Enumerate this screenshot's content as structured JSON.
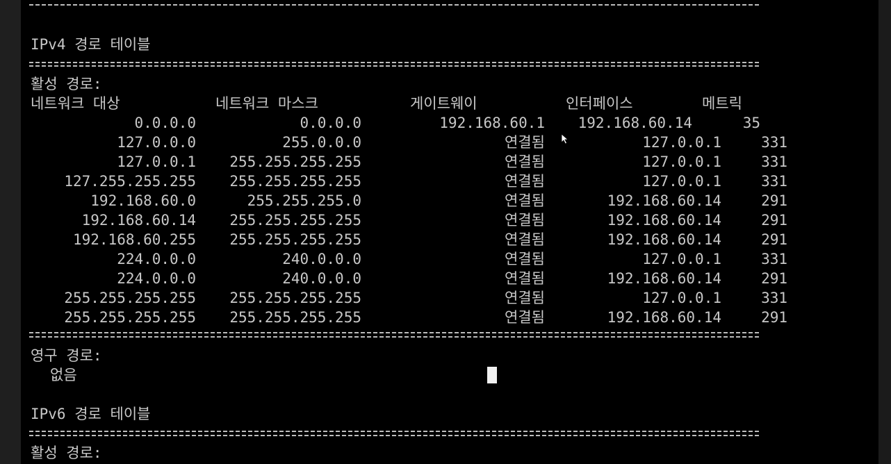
{
  "ipv4": {
    "title": "IPv4 경로 테이블",
    "active_label": "활성 경로:",
    "headers": {
      "destination": "네트워크 대상",
      "mask": "네트워크 마스크",
      "gateway": "게이트웨이",
      "interface": "인터페이스",
      "metric": "메트릭"
    },
    "rows": [
      {
        "destination": "0.0.0.0",
        "mask": "0.0.0.0",
        "gateway": "192.168.60.1",
        "interface": "192.168.60.14",
        "metric": "35"
      },
      {
        "destination": "127.0.0.0",
        "mask": "255.0.0.0",
        "gateway": "연결됨",
        "interface": "127.0.0.1",
        "metric": "331"
      },
      {
        "destination": "127.0.0.1",
        "mask": "255.255.255.255",
        "gateway": "연결됨",
        "interface": "127.0.0.1",
        "metric": "331"
      },
      {
        "destination": "127.255.255.255",
        "mask": "255.255.255.255",
        "gateway": "연결됨",
        "interface": "127.0.0.1",
        "metric": "331"
      },
      {
        "destination": "192.168.60.0",
        "mask": "255.255.255.0",
        "gateway": "연결됨",
        "interface": "192.168.60.14",
        "metric": "291"
      },
      {
        "destination": "192.168.60.14",
        "mask": "255.255.255.255",
        "gateway": "연결됨",
        "interface": "192.168.60.14",
        "metric": "291"
      },
      {
        "destination": "192.168.60.255",
        "mask": "255.255.255.255",
        "gateway": "연결됨",
        "interface": "192.168.60.14",
        "metric": "291"
      },
      {
        "destination": "224.0.0.0",
        "mask": "240.0.0.0",
        "gateway": "연결됨",
        "interface": "127.0.0.1",
        "metric": "331"
      },
      {
        "destination": "224.0.0.0",
        "mask": "240.0.0.0",
        "gateway": "연결됨",
        "interface": "192.168.60.14",
        "metric": "291"
      },
      {
        "destination": "255.255.255.255",
        "mask": "255.255.255.255",
        "gateway": "연결됨",
        "interface": "127.0.0.1",
        "metric": "331"
      },
      {
        "destination": "255.255.255.255",
        "mask": "255.255.255.255",
        "gateway": "연결됨",
        "interface": "192.168.60.14",
        "metric": "291"
      }
    ],
    "persistent_label": "영구 경로:",
    "persistent_value": "없음"
  },
  "ipv6": {
    "title": "IPv6 경로 테이블",
    "active_label": "활성 경로:"
  },
  "colors": {
    "background": "#000000",
    "text": "#c8c8c8",
    "cursor": "#f0f0f0"
  }
}
